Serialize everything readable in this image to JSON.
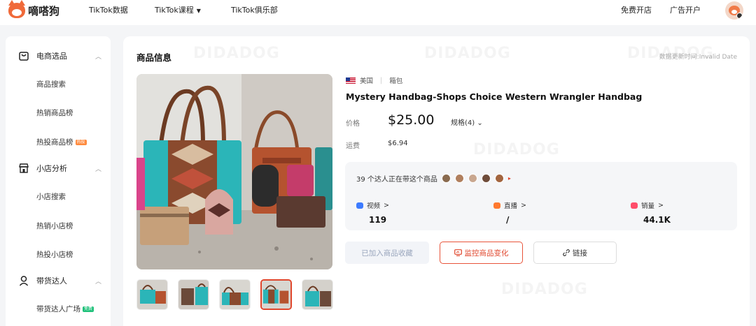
{
  "app": {
    "name": "嘀嗒狗"
  },
  "nav": {
    "items": [
      {
        "label": "TikTok数据"
      },
      {
        "label": "TikTok课程",
        "caret": "▼"
      },
      {
        "label": "TikTok俱乐部"
      }
    ],
    "right": [
      {
        "label": "免费开店"
      },
      {
        "label": "广告开户"
      }
    ]
  },
  "sidebar": {
    "groups": [
      {
        "label": "电商选品",
        "icon": "cart-icon",
        "caret": "︿",
        "items": [
          {
            "label": "商品搜索"
          },
          {
            "label": "热销商品榜"
          },
          {
            "label": "热投商品榜",
            "tag": "热投"
          }
        ]
      },
      {
        "label": "小店分析",
        "icon": "shop-icon",
        "caret": "︿",
        "items": [
          {
            "label": "小店搜索"
          },
          {
            "label": "热销小店榜"
          },
          {
            "label": "热投小店榜"
          }
        ]
      },
      {
        "label": "带货达人",
        "icon": "user-icon",
        "caret": "︿",
        "items": [
          {
            "label": "带货达人广场",
            "tag": "免费"
          }
        ]
      }
    ]
  },
  "main": {
    "section_title": "商品信息",
    "update_time": "数据更新时间:Invalid Date",
    "watermark": "DIDADOG",
    "product": {
      "country": "美国",
      "category": "箱包",
      "title": "Mystery Handbag-Shops Choice Western Wrangler Handbag",
      "price_label": "价格",
      "price": "$25.00",
      "spec": "规格(4)",
      "spec_caret": "⌄",
      "shipping_label": "运费",
      "shipping": "$6.94"
    },
    "stats": {
      "creators_text": "39 个达人正在带这个商品",
      "creator_faces": [
        "#8a6b4f",
        "#b07f5e",
        "#c9a78f",
        "#6f4c3a",
        "#a3653f"
      ],
      "more": "▸",
      "items": [
        {
          "label": "视频",
          "value": "119",
          "arrow": ">",
          "color": "#3d7bff"
        },
        {
          "label": "直播",
          "value": "/",
          "arrow": ">",
          "color": "#ff7a2f"
        },
        {
          "label": "销量",
          "value": "44.1K",
          "arrow": ">",
          "color": "#ff4d6a"
        }
      ]
    },
    "buttons": {
      "favorite": "已加入商品收藏",
      "monitor": "监控商品变化",
      "link": "链接"
    },
    "thumbnails": {
      "count": 5,
      "active_index": 3
    }
  }
}
